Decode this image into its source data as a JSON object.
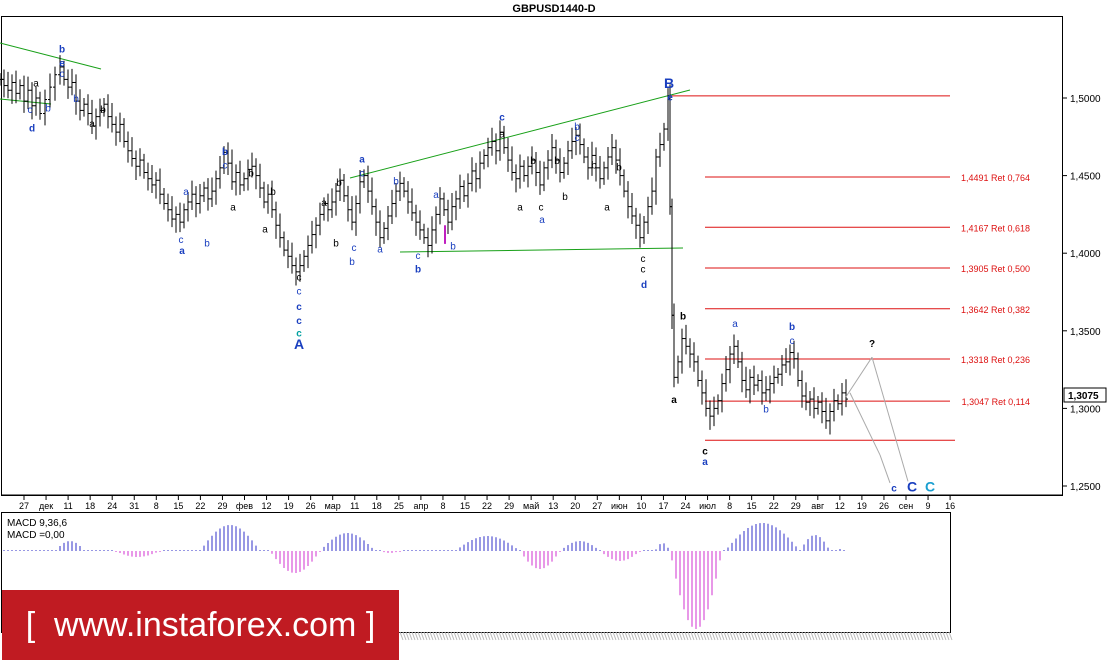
{
  "chart_data": {
    "type": "ohlc",
    "title": "GBPUSD1440-D",
    "current_price": "1,3075",
    "ylim": [
      1.235,
      1.54
    ],
    "ytick_labels": [
      "1,5000",
      "1,4500",
      "1,4000",
      "1,3500",
      "1,3000",
      "1,2500"
    ],
    "xtick_labels": [
      "27",
      "дек",
      "11",
      "18",
      "24",
      "31",
      "8",
      "15",
      "22",
      "29",
      "фев",
      "12",
      "19",
      "26",
      "мар",
      "11",
      "18",
      "25",
      "апр",
      "8",
      "15",
      "22",
      "29",
      "май",
      "13",
      "20",
      "27",
      "июн",
      "10",
      "17",
      "24",
      "июл",
      "8",
      "15",
      "22",
      "29",
      "авг",
      "12",
      "19",
      "26",
      "сен",
      "9",
      "16"
    ],
    "fib_levels": [
      {
        "price": 1.4491,
        "label": "1,4491 Ret 0,764"
      },
      {
        "price": 1.4167,
        "label": "1,4167 Ret 0,618"
      },
      {
        "price": 1.3905,
        "label": "1,3905 Ret 0,500"
      },
      {
        "price": 1.3642,
        "label": "1,3642 Ret 0,382"
      },
      {
        "price": 1.3318,
        "label": "1,3318 Ret 0,236"
      },
      {
        "price": 1.3047,
        "label": "1,3047 Ret 0,114"
      }
    ],
    "price_path": [
      [
        1,
        1.512
      ],
      [
        4,
        1.508
      ],
      [
        8,
        1.505
      ],
      [
        12,
        1.51
      ],
      [
        16,
        1.503
      ],
      [
        20,
        1.508
      ],
      [
        24,
        1.498
      ],
      [
        28,
        1.505
      ],
      [
        32,
        1.495
      ],
      [
        36,
        1.5
      ],
      [
        40,
        1.49
      ],
      [
        45,
        1.499
      ],
      [
        50,
        1.507
      ],
      [
        55,
        1.515
      ],
      [
        60,
        1.52
      ],
      [
        64,
        1.512
      ],
      [
        68,
        1.507
      ],
      [
        72,
        1.51
      ],
      [
        76,
        1.498
      ],
      [
        80,
        1.492
      ],
      [
        84,
        1.496
      ],
      [
        88,
        1.49
      ],
      [
        92,
        1.482
      ],
      [
        96,
        1.488
      ],
      [
        100,
        1.492
      ],
      [
        104,
        1.496
      ],
      [
        108,
        1.488
      ],
      [
        112,
        1.483
      ],
      [
        116,
        1.478
      ],
      [
        120,
        1.483
      ],
      [
        124,
        1.472
      ],
      [
        128,
        1.466
      ],
      [
        132,
        1.461
      ],
      [
        136,
        1.456
      ],
      [
        140,
        1.46
      ],
      [
        144,
        1.452
      ],
      [
        148,
        1.448
      ],
      [
        152,
        1.444
      ],
      [
        156,
        1.447
      ],
      [
        160,
        1.438
      ],
      [
        164,
        1.432
      ],
      [
        168,
        1.428
      ],
      [
        172,
        1.422
      ],
      [
        176,
        1.425
      ],
      [
        180,
        1.42
      ],
      [
        184,
        1.428
      ],
      [
        188,
        1.433
      ],
      [
        192,
        1.438
      ],
      [
        196,
        1.432
      ],
      [
        200,
        1.437
      ],
      [
        204,
        1.442
      ],
      [
        208,
        1.435
      ],
      [
        212,
        1.44
      ],
      [
        216,
        1.448
      ],
      [
        220,
        1.455
      ],
      [
        224,
        1.465
      ],
      [
        228,
        1.458
      ],
      [
        232,
        1.446
      ],
      [
        236,
        1.452
      ],
      [
        240,
        1.444
      ],
      [
        244,
        1.448
      ],
      [
        248,
        1.454
      ],
      [
        252,
        1.456
      ],
      [
        256,
        1.45
      ],
      [
        260,
        1.442
      ],
      [
        264,
        1.433
      ],
      [
        268,
        1.438
      ],
      [
        272,
        1.428
      ],
      [
        276,
        1.418
      ],
      [
        280,
        1.41
      ],
      [
        284,
        1.402
      ],
      [
        288,
        1.398
      ],
      [
        292,
        1.392
      ],
      [
        296,
        1.388
      ],
      [
        300,
        1.392
      ],
      [
        304,
        1.398
      ],
      [
        308,
        1.405
      ],
      [
        312,
        1.412
      ],
      [
        316,
        1.418
      ],
      [
        320,
        1.425
      ],
      [
        324,
        1.432
      ],
      [
        328,
        1.428
      ],
      [
        332,
        1.433
      ],
      [
        336,
        1.44
      ],
      [
        340,
        1.447
      ],
      [
        344,
        1.437
      ],
      [
        348,
        1.428
      ],
      [
        352,
        1.42
      ],
      [
        356,
        1.432
      ],
      [
        360,
        1.446
      ],
      [
        364,
        1.45
      ],
      [
        368,
        1.44
      ],
      [
        372,
        1.43
      ],
      [
        376,
        1.42
      ],
      [
        380,
        1.41
      ],
      [
        384,
        1.416
      ],
      [
        388,
        1.424
      ],
      [
        392,
        1.432
      ],
      [
        396,
        1.44
      ],
      [
        400,
        1.445
      ],
      [
        404,
        1.44
      ],
      [
        408,
        1.433
      ],
      [
        412,
        1.426
      ],
      [
        416,
        1.42
      ],
      [
        420,
        1.415
      ],
      [
        424,
        1.41
      ],
      [
        428,
        1.405
      ],
      [
        432,
        1.415
      ],
      [
        436,
        1.425
      ],
      [
        440,
        1.435
      ],
      [
        444,
        1.428
      ],
      [
        448,
        1.42
      ],
      [
        452,
        1.43
      ],
      [
        456,
        1.435
      ],
      [
        460,
        1.443
      ],
      [
        464,
        1.437
      ],
      [
        468,
        1.445
      ],
      [
        472,
        1.453
      ],
      [
        476,
        1.448
      ],
      [
        480,
        1.458
      ],
      [
        484,
        1.463
      ],
      [
        488,
        1.468
      ],
      [
        492,
        1.472
      ],
      [
        496,
        1.466
      ],
      [
        500,
        1.478
      ],
      [
        504,
        1.468
      ],
      [
        508,
        1.46
      ],
      [
        512,
        1.452
      ],
      [
        516,
        1.448
      ],
      [
        520,
        1.456
      ],
      [
        524,
        1.45
      ],
      [
        528,
        1.456
      ],
      [
        532,
        1.46
      ],
      [
        536,
        1.452
      ],
      [
        540,
        1.444
      ],
      [
        544,
        1.455
      ],
      [
        548,
        1.46
      ],
      [
        552,
        1.468
      ],
      [
        556,
        1.46
      ],
      [
        560,
        1.452
      ],
      [
        564,
        1.458
      ],
      [
        568,
        1.466
      ],
      [
        572,
        1.472
      ],
      [
        576,
        1.476
      ],
      [
        580,
        1.47
      ],
      [
        584,
        1.462
      ],
      [
        588,
        1.455
      ],
      [
        592,
        1.463
      ],
      [
        596,
        1.455
      ],
      [
        600,
        1.448
      ],
      [
        604,
        1.455
      ],
      [
        608,
        1.462
      ],
      [
        612,
        1.468
      ],
      [
        616,
        1.46
      ],
      [
        620,
        1.45
      ],
      [
        624,
        1.44
      ],
      [
        628,
        1.43
      ],
      [
        632,
        1.424
      ],
      [
        636,
        1.418
      ],
      [
        640,
        1.41
      ],
      [
        644,
        1.42
      ],
      [
        648,
        1.43
      ],
      [
        652,
        1.44
      ],
      [
        656,
        1.462
      ],
      [
        660,
        1.47
      ],
      [
        664,
        1.48
      ],
      [
        668,
        1.5
      ],
      [
        670,
        1.43
      ],
      [
        672,
        1.36
      ],
      [
        674,
        1.32
      ],
      [
        678,
        1.33
      ],
      [
        682,
        1.345
      ],
      [
        686,
        1.34
      ],
      [
        690,
        1.335
      ],
      [
        694,
        1.33
      ],
      [
        698,
        1.318
      ],
      [
        702,
        1.31
      ],
      [
        706,
        1.3
      ],
      [
        710,
        1.295
      ],
      [
        714,
        1.3
      ],
      [
        718,
        1.305
      ],
      [
        722,
        1.316
      ],
      [
        726,
        1.325
      ],
      [
        730,
        1.335
      ],
      [
        734,
        1.34
      ],
      [
        738,
        1.33
      ],
      [
        742,
        1.318
      ],
      [
        746,
        1.312
      ],
      [
        750,
        1.32
      ],
      [
        754,
        1.315
      ],
      [
        758,
        1.318
      ],
      [
        762,
        1.31
      ],
      [
        766,
        1.312
      ],
      [
        770,
        1.316
      ],
      [
        774,
        1.32
      ],
      [
        778,
        1.322
      ],
      [
        782,
        1.328
      ],
      [
        786,
        1.33
      ],
      [
        790,
        1.336
      ],
      [
        794,
        1.332
      ],
      [
        798,
        1.318
      ],
      [
        802,
        1.308
      ],
      [
        806,
        1.304
      ],
      [
        810,
        1.306
      ],
      [
        814,
        1.3
      ],
      [
        818,
        1.304
      ],
      [
        822,
        1.298
      ],
      [
        826,
        1.292
      ],
      [
        830,
        1.298
      ],
      [
        834,
        1.305
      ],
      [
        838,
        1.303
      ],
      [
        842,
        1.31
      ],
      [
        846,
        1.306
      ]
    ],
    "projection": [
      [
        846,
        1.3075
      ],
      [
        872,
        1.333
      ],
      [
        908,
        1.253
      ]
    ],
    "wave_labels": [
      {
        "text": "b",
        "x": 62,
        "price": 1.532,
        "color": "#1a3fbf",
        "bold": true
      },
      {
        "text": "e",
        "x": 62,
        "price": 1.523,
        "color": "#1a3fbf",
        "bold": true
      },
      {
        "text": "c",
        "x": 62,
        "price": 1.516,
        "color": "#1a3fbf"
      },
      {
        "text": "a",
        "x": 36,
        "price": 1.51,
        "color": "#000"
      },
      {
        "text": "c",
        "x": 30,
        "price": 1.493,
        "color": "#1a3fbf"
      },
      {
        "text": "b",
        "x": 48,
        "price": 1.494,
        "color": "#1a3fbf"
      },
      {
        "text": "d",
        "x": 32,
        "price": 1.481,
        "color": "#1a3fbf",
        "bold": true
      },
      {
        "text": "b",
        "x": 76,
        "price": 1.5,
        "color": "#1a3fbf"
      },
      {
        "text": "b",
        "x": 103,
        "price": 1.493,
        "color": "#000"
      },
      {
        "text": "a",
        "x": 92,
        "price": 1.484,
        "color": "#000"
      },
      {
        "text": "b",
        "x": 225,
        "price": 1.466,
        "color": "#1a3fbf",
        "bold": true
      },
      {
        "text": "c",
        "x": 225,
        "price": 1.457,
        "color": "#1a3fbf"
      },
      {
        "text": "b",
        "x": 251,
        "price": 1.452,
        "color": "#000"
      },
      {
        "text": "a",
        "x": 186,
        "price": 1.44,
        "color": "#1a3fbf"
      },
      {
        "text": "b",
        "x": 273,
        "price": 1.44,
        "color": "#000"
      },
      {
        "text": "a",
        "x": 233,
        "price": 1.43,
        "color": "#000"
      },
      {
        "text": "a",
        "x": 265,
        "price": 1.416,
        "color": "#000"
      },
      {
        "text": "c",
        "x": 181,
        "price": 1.409,
        "color": "#1a3fbf"
      },
      {
        "text": "a",
        "x": 182,
        "price": 1.402,
        "color": "#1a3fbf",
        "bold": true
      },
      {
        "text": "b",
        "x": 207,
        "price": 1.407,
        "color": "#1a3fbf"
      },
      {
        "text": "c",
        "x": 299,
        "price": 1.385,
        "color": "#000"
      },
      {
        "text": "c",
        "x": 299,
        "price": 1.376,
        "color": "#1a3fbf"
      },
      {
        "text": "c",
        "x": 299,
        "price": 1.366,
        "color": "#1a3fbf",
        "bold": true
      },
      {
        "text": "c",
        "x": 299,
        "price": 1.357,
        "color": "#1a3fbf",
        "bold": true
      },
      {
        "text": "c",
        "x": 299,
        "price": 1.349,
        "color": "#00a0a0",
        "bold": true
      },
      {
        "text": "A",
        "x": 299,
        "price": 1.341,
        "color": "#1a3fbf",
        "bold": true,
        "big": true
      },
      {
        "text": "a",
        "x": 362,
        "price": 1.461,
        "color": "#1a3fbf",
        "bold": true
      },
      {
        "text": "c",
        "x": 362,
        "price": 1.452,
        "color": "#1a3fbf"
      },
      {
        "text": "b",
        "x": 339,
        "price": 1.446,
        "color": "#000"
      },
      {
        "text": "a",
        "x": 324,
        "price": 1.433,
        "color": "#000"
      },
      {
        "text": "b",
        "x": 396,
        "price": 1.447,
        "color": "#1a3fbf"
      },
      {
        "text": "c",
        "x": 354,
        "price": 1.404,
        "color": "#1a3fbf"
      },
      {
        "text": "b",
        "x": 336,
        "price": 1.407,
        "color": "#000"
      },
      {
        "text": "b",
        "x": 352,
        "price": 1.395,
        "color": "#1a3fbf"
      },
      {
        "text": "a",
        "x": 380,
        "price": 1.403,
        "color": "#1a3fbf"
      },
      {
        "text": "c",
        "x": 418,
        "price": 1.399,
        "color": "#1a3fbf"
      },
      {
        "text": "b",
        "x": 418,
        "price": 1.39,
        "color": "#1a3fbf",
        "bold": true
      },
      {
        "text": "b",
        "x": 453,
        "price": 1.405,
        "color": "#1a3fbf"
      },
      {
        "text": "a",
        "x": 436,
        "price": 1.438,
        "color": "#1a3fbf"
      },
      {
        "text": "c",
        "x": 502,
        "price": 1.488,
        "color": "#1a3fbf",
        "bold": true
      },
      {
        "text": "a",
        "x": 502,
        "price": 1.477,
        "color": "#000"
      },
      {
        "text": "b",
        "x": 577,
        "price": 1.482,
        "color": "#1a3fbf"
      },
      {
        "text": "c",
        "x": 577,
        "price": 1.475,
        "color": "#1a3fbf"
      },
      {
        "text": "b",
        "x": 533,
        "price": 1.46,
        "color": "#000"
      },
      {
        "text": "b",
        "x": 557,
        "price": 1.46,
        "color": "#000"
      },
      {
        "text": "b",
        "x": 594,
        "price": 1.457,
        "color": "#000"
      },
      {
        "text": "b",
        "x": 619,
        "price": 1.456,
        "color": "#000"
      },
      {
        "text": "a",
        "x": 520,
        "price": 1.43,
        "color": "#000"
      },
      {
        "text": "c",
        "x": 541,
        "price": 1.43,
        "color": "#000"
      },
      {
        "text": "a",
        "x": 542,
        "price": 1.422,
        "color": "#1a3fbf"
      },
      {
        "text": "b",
        "x": 565,
        "price": 1.437,
        "color": "#000"
      },
      {
        "text": "a",
        "x": 607,
        "price": 1.43,
        "color": "#000"
      },
      {
        "text": "c",
        "x": 643,
        "price": 1.397,
        "color": "#000"
      },
      {
        "text": "c",
        "x": 643,
        "price": 1.39,
        "color": "#000"
      },
      {
        "text": "d",
        "x": 644,
        "price": 1.38,
        "color": "#1a3fbf",
        "bold": true
      },
      {
        "text": "B",
        "x": 669,
        "price": 1.509,
        "color": "#1a3fbf",
        "bold": true,
        "big": true
      },
      {
        "text": "e",
        "x": 670,
        "price": 1.501,
        "color": "#1a3fbf",
        "bold": true
      },
      {
        "text": "b",
        "x": 683,
        "price": 1.36,
        "color": "#000",
        "bold": true
      },
      {
        "text": "a",
        "x": 674,
        "price": 1.306,
        "color": "#000",
        "bold": true
      },
      {
        "text": "a",
        "x": 735,
        "price": 1.355,
        "color": "#1a3fbf"
      },
      {
        "text": "b",
        "x": 792,
        "price": 1.353,
        "color": "#1a3fbf",
        "bold": true
      },
      {
        "text": "c",
        "x": 792,
        "price": 1.344,
        "color": "#1a3fbf"
      },
      {
        "text": "b",
        "x": 766,
        "price": 1.3,
        "color": "#1a3fbf"
      },
      {
        "text": "c",
        "x": 705,
        "price": 1.273,
        "color": "#000",
        "bold": true
      },
      {
        "text": "a",
        "x": 705,
        "price": 1.266,
        "color": "#1a3fbf",
        "bold": true
      },
      {
        "text": "?",
        "x": 872,
        "price": 1.342,
        "color": "#000",
        "bold": true
      },
      {
        "text": "c",
        "x": 894,
        "price": 1.249,
        "color": "#1a3fbf",
        "bold": true
      },
      {
        "text": "C",
        "x": 912,
        "price": 1.249,
        "color": "#1a3fbf",
        "bold": true,
        "big": true
      },
      {
        "text": "C",
        "x": 930,
        "price": 1.249,
        "color": "#1a9fd0",
        "bold": true,
        "big": true
      }
    ],
    "macd_label_1": "MACD 9,36,6",
    "macd_label_2": "MACD =0,00"
  },
  "banner": {
    "text": "[  www.instaforex.com ]",
    "color": "#c01b22"
  }
}
